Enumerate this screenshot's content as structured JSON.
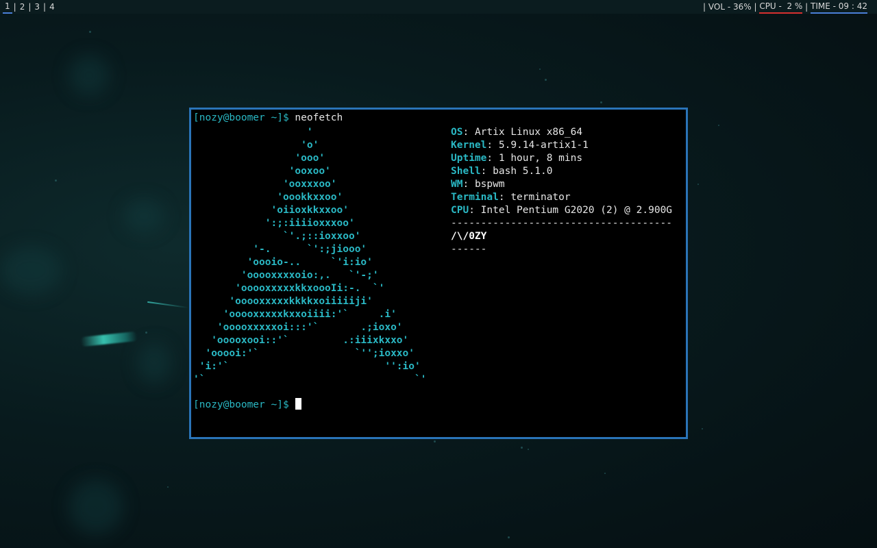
{
  "bar": {
    "workspaces": [
      "1",
      "2",
      "3",
      "4"
    ],
    "active_workspace": "1",
    "volume": "| VOL - 36% | ",
    "cpu": "CPU -  2 %",
    "time_sep": " | ",
    "time": "TIME - 09 : 42",
    "colors": {
      "active_underline": "#4a7fd8",
      "cpu_underline": "#d83030"
    }
  },
  "terminal": {
    "prompt": "[nozy@boomer ~]$",
    "command": "neofetch",
    "ascii_logo": "                   '\n                  'o'\n                 'ooo'\n                'ooxoo'\n               'ooxxxoo'\n              'oookkxxoo'\n             'oiioxkkxxoo'\n            ':;:iiiioxxxoo'\n               `'.;::ioxxoo'\n          '-.      `':;jiooo'\n         'oooio-..     `'i:io'\n        'ooooxxxxoio:,.   `'-;'\n       'ooooxxxxxkkxoooIi:-.  `'\n      'ooooxxxxxkkkkxoiiiiiji'\n     'ooooxxxxxkxxoiiii:'`     .i'\n    'ooooxxxxxoi:::'`       .;ioxo'\n   'ooooxooi::'`         .:iiixkxxo'\n  'ooooi:'`                `'';ioxxo'\n 'i:'`                          '':io'\n'`                                   `'",
    "info": [
      {
        "key": "OS",
        "value": "Artix Linux x86_64"
      },
      {
        "key": "Kernel",
        "value": "5.9.14-artix1-1"
      },
      {
        "key": "Uptime",
        "value": "1 hour, 8 mins"
      },
      {
        "key": "Shell",
        "value": "bash 5.1.0"
      },
      {
        "key": "WM",
        "value": "bspwm"
      },
      {
        "key": "Terminal",
        "value": "terminator"
      },
      {
        "key": "CPU",
        "value": "Intel Pentium G2020 (2) @ 2.900G"
      }
    ],
    "divider": "-------------------------------------",
    "user_tag": "/\\/0ZY",
    "user_underline": "------",
    "second_prompt": "[nozy@boomer ~]$",
    "colors": {
      "accent": "#2ab8c4",
      "border": "#2a74b8",
      "background": "#000000"
    }
  }
}
